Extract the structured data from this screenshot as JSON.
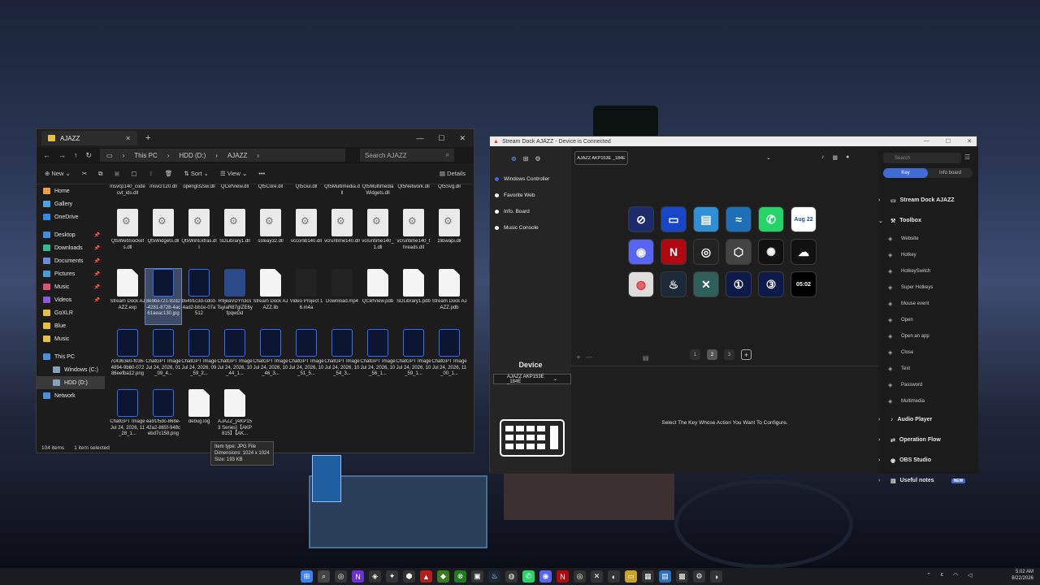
{
  "explorer": {
    "tab_title": "AJAZZ",
    "breadcrumb": [
      "This PC",
      "HDD (D:)",
      "AJAZZ"
    ],
    "search_placeholder": "Search AJAZZ",
    "toolbar": {
      "new": "New",
      "sort": "Sort",
      "view": "View",
      "more": "•••",
      "details": "Details"
    },
    "nav": [
      {
        "label": "Home",
        "color": "#e8a341"
      },
      {
        "label": "Gallery",
        "color": "#4aa3e0"
      },
      {
        "label": "OneDrive",
        "color": "#2f8be6"
      },
      {
        "label": "Desktop",
        "color": "#3f8fe0",
        "pinned": true
      },
      {
        "label": "Downloads",
        "color": "#2fbf8f",
        "pinned": true
      },
      {
        "label": "Documents",
        "color": "#6b8fd6",
        "pinned": true
      },
      {
        "label": "Pictures",
        "color": "#3fa0e0",
        "pinned": true
      },
      {
        "label": "Music",
        "color": "#e0507a",
        "pinned": true
      },
      {
        "label": "Videos",
        "color": "#8a5ae0",
        "pinned": true
      },
      {
        "label": "GoXLR",
        "color": "#e6c141"
      },
      {
        "label": "Blue",
        "color": "#e6c141"
      },
      {
        "label": "Music",
        "color": "#e6c141"
      },
      {
        "label": "This PC",
        "color": "#4a90e2"
      },
      {
        "label": "Windows (C:)",
        "color": "#8aa0b8"
      },
      {
        "label": "HDD (D:)",
        "color": "#8aa0b8",
        "selected": true
      },
      {
        "label": "Network",
        "color": "#4a90e2"
      }
    ],
    "files_top": [
      "msvcp140_codecvt_ids.dll",
      "msvcr120.dll",
      "opengl32sw.dll",
      "QCefView.dll",
      "Qt5Core.dll",
      "Qt5Gui.dll",
      "Qt5Multimedia.dll",
      "Qt5MultimediaWidgets.dll",
      "Qt5Network.dll",
      "Qt5Svg.dll"
    ],
    "files": [
      {
        "name": "Qt5WebSockets.dll",
        "kind": "dll"
      },
      {
        "name": "Qt5Widgets.dll",
        "kind": "dll"
      },
      {
        "name": "Qt5WinExtras.dll",
        "kind": "dll"
      },
      {
        "name": "SDLibrary1.dll",
        "kind": "dll"
      },
      {
        "name": "ssleay32.dll",
        "kind": "dll"
      },
      {
        "name": "vccorlib140.dll",
        "kind": "dll"
      },
      {
        "name": "vcruntime140.dll",
        "kind": "dll"
      },
      {
        "name": "vcruntime140_1.dll",
        "kind": "dll"
      },
      {
        "name": "vcruntime140_threads.dll",
        "kind": "dll"
      },
      {
        "name": "zlibwapi.dll",
        "kind": "dll"
      },
      {
        "name": "Stream Dock AJAZZ.exp",
        "kind": "doc"
      },
      {
        "name": "8e9be721-92d2-4281-8728-4ac61aeac130.jpg",
        "kind": "img",
        "selected": true
      },
      {
        "name": "b5491c3d-cdcd-4ad2-bb1e-07a512",
        "kind": "img"
      },
      {
        "name": "R9jeaVDYn3csTsyiaR87gIZE6yfpqwGd",
        "kind": "vid"
      },
      {
        "name": "Stream Dock AJAZZ.lib",
        "kind": "doc"
      },
      {
        "name": "Video Project 16.m4a",
        "kind": "media"
      },
      {
        "name": "Download.mp4",
        "kind": "media"
      },
      {
        "name": "QCefView.pdb",
        "kind": "doc"
      },
      {
        "name": "SDLibrary1.pdb",
        "kind": "doc"
      },
      {
        "name": "Stream Dock AJAZZ.pdb",
        "kind": "doc"
      },
      {
        "name": "7c4363e0-f036-4894-9b60-07286eefba12.png",
        "kind": "img"
      },
      {
        "name": "ChatGPT Image Jul 24, 2026, 01_09_4...",
        "kind": "img"
      },
      {
        "name": "ChatGPT Image Jul 24, 2026, 09_59_2...",
        "kind": "img"
      },
      {
        "name": "ChatGPT Image Jul 24, 2026, 10_44_1...",
        "kind": "img"
      },
      {
        "name": "ChatGPT Image Jul 24, 2026, 10_46_3...",
        "kind": "img"
      },
      {
        "name": "ChatGPT Image Jul 24, 2026, 10_51_5...",
        "kind": "img"
      },
      {
        "name": "ChatGPT Image Jul 24, 2026, 10_54_3...",
        "kind": "img"
      },
      {
        "name": "ChatGPT Image Jul 24, 2026, 10_56_1...",
        "kind": "img"
      },
      {
        "name": "ChatGPT Image Jul 24, 2026, 10_59_1...",
        "kind": "img"
      },
      {
        "name": "ChatGPT Image Jul 24, 2026, 11_00_1...",
        "kind": "img"
      },
      {
        "name": "ChatGPT Image Jul 24, 2026, 11_28_1...",
        "kind": "img"
      },
      {
        "name": "ea91f5dc-868e-42a2-865f-948cebd7c158.png",
        "kind": "img"
      },
      {
        "name": "debug.log",
        "kind": "doc"
      },
      {
        "name": "AJAZZ_[AKP153 Series]【AKP815】【AK...",
        "kind": "doc"
      }
    ],
    "tooltip": [
      "Item type: JPG File",
      "Dimensions: 1024 x 1024",
      "Size: 193 KB"
    ],
    "status": {
      "items": "104 items",
      "selected": "1 item selected"
    }
  },
  "streamdock": {
    "title": "Stream Dock AJAZZ - Device is Connected",
    "profiles": [
      "Windows Controller",
      "Favorite Web",
      "Info. Board",
      "Music Console"
    ],
    "device_label": "Device",
    "device_select": "AJAZZ AKP153E _184E",
    "device_chip": "AJAZZ AKP153E _184E",
    "keys": [
      {
        "icon": "playstation-icon",
        "bg": "#1d2a6b",
        "glyph": "⊘"
      },
      {
        "icon": "folder-icon",
        "bg": "#1746c9",
        "glyph": "▭"
      },
      {
        "icon": "explorer-icon",
        "bg": "#2f8fd6",
        "glyph": "▤"
      },
      {
        "icon": "waves-icon",
        "bg": "#1d6fb8",
        "glyph": "≈"
      },
      {
        "icon": "whatsapp-icon",
        "bg": "#25d366",
        "glyph": "✆"
      },
      {
        "icon": "calendar-icon",
        "bg": "#ffffff",
        "glyph": "",
        "text": "Aug 22",
        "fg": "#1a4fa0"
      },
      {
        "icon": "discord-icon",
        "bg": "#5865f2",
        "glyph": "◉"
      },
      {
        "icon": "netflix-icon",
        "bg": "#b00710",
        "glyph": "N"
      },
      {
        "icon": "obs-icon",
        "bg": "#222222",
        "glyph": "◎"
      },
      {
        "icon": "unity-icon",
        "bg": "#444444",
        "glyph": "⬡"
      },
      {
        "icon": "chatgpt-icon",
        "bg": "#111111",
        "glyph": "✺"
      },
      {
        "icon": "weather-icon",
        "bg": "#111111",
        "glyph": "☁"
      },
      {
        "icon": "chrome-icon",
        "bg": "#dddddd",
        "glyph": "◍",
        "fg": "#d33"
      },
      {
        "icon": "steam-icon",
        "bg": "#1b2838",
        "glyph": "♨"
      },
      {
        "icon": "goxlr-icon",
        "bg": "#2f5f5a",
        "glyph": "✕"
      },
      {
        "icon": "page1-icon",
        "bg": "#0b1a4a",
        "glyph": "①"
      },
      {
        "icon": "page3-icon",
        "bg": "#0b1a4a",
        "glyph": "③"
      },
      {
        "icon": "clock-icon",
        "bg": "#000000",
        "glyph": "",
        "text": "05:02"
      }
    ],
    "pages": [
      "1",
      "2",
      "3",
      "+"
    ],
    "current_page": "2",
    "hint": "Select The Key Whose Action You Want To Configure.",
    "search_placeholder": "Search",
    "tabs": [
      "Key",
      "Info board"
    ],
    "categories": [
      {
        "label": "Stream Dock AJAZZ",
        "open": false
      },
      {
        "label": "Toolbox",
        "open": true,
        "actions": [
          "Website",
          "Hotkey",
          "HotkeySwitch",
          "Super Hotkeys",
          "Mouse event",
          "Open",
          "Open an app",
          "Close",
          "Text",
          "Password",
          "Multimedia"
        ]
      },
      {
        "label": "Audio Player",
        "open": false
      },
      {
        "label": "Operation Flow",
        "open": false
      },
      {
        "label": "OBS Studio",
        "open": false
      },
      {
        "label": "Useful notes",
        "open": false,
        "badge": "NEW"
      }
    ]
  },
  "taskbar": {
    "time": "5:02 AM",
    "date": "8/22/2026",
    "lang": "ε"
  }
}
